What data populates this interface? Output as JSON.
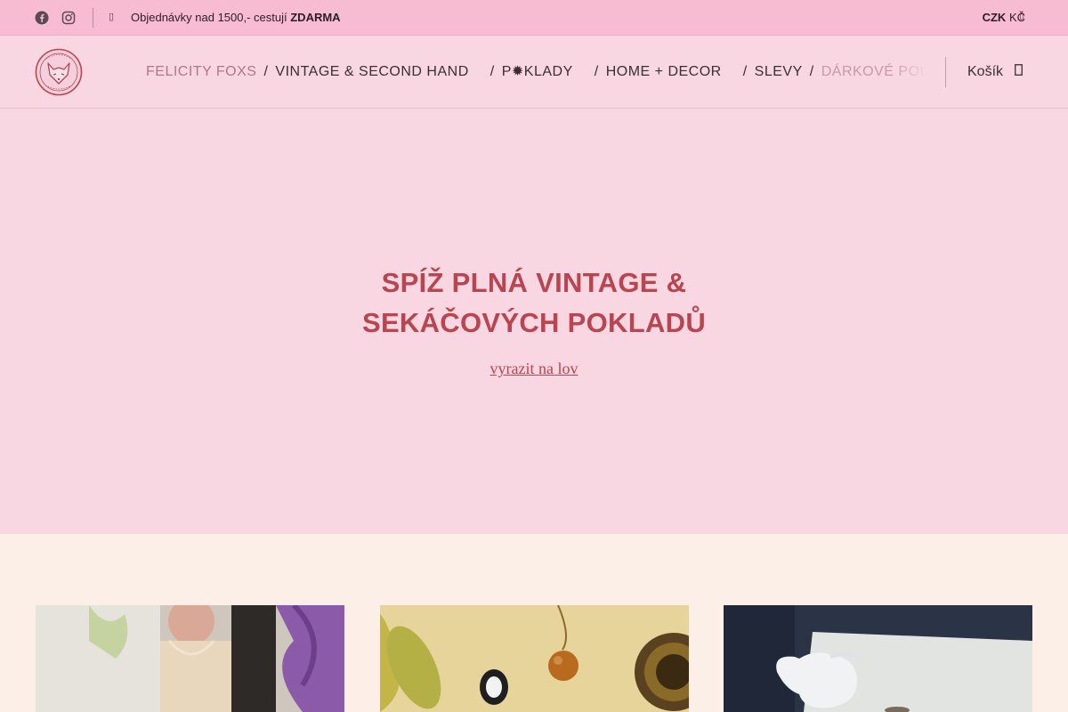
{
  "topbar": {
    "social": [
      {
        "icon": "facebook-icon"
      },
      {
        "icon": "instagram-icon"
      }
    ],
    "promo_icon": "truck-icon",
    "promo_text": "Objednávky nad 1500,- cestují ",
    "promo_bold": "ZDARMA",
    "currency_code": "CZK",
    "currency_symbol": "KČ"
  },
  "header": {
    "nav": [
      {
        "label": "FELICITY FOXS",
        "state": "active"
      },
      {
        "label": "VINTAGE & SECOND HAND",
        "state": "normal"
      },
      {
        "label": "P✹KLADY",
        "state": "normal"
      },
      {
        "label": "HOME + DECOR",
        "state": "normal"
      },
      {
        "label": "SLEVY",
        "state": "normal"
      },
      {
        "label": "DÁRKOVÉ POUKAZY",
        "state": "faded"
      }
    ],
    "separator": "/",
    "cart_label": "Košík"
  },
  "hero": {
    "title_line1": "SPÍŽ PLNÁ VINTAGE &",
    "title_line2": "SEKÁČOVÝCH POKLADŮ",
    "cta": "vyrazit na lov"
  },
  "colors": {
    "topbar": "#f8bcd2",
    "background": "#f8d7e3",
    "accent": "#b8454f",
    "tiles_background": "#fcefe8"
  }
}
